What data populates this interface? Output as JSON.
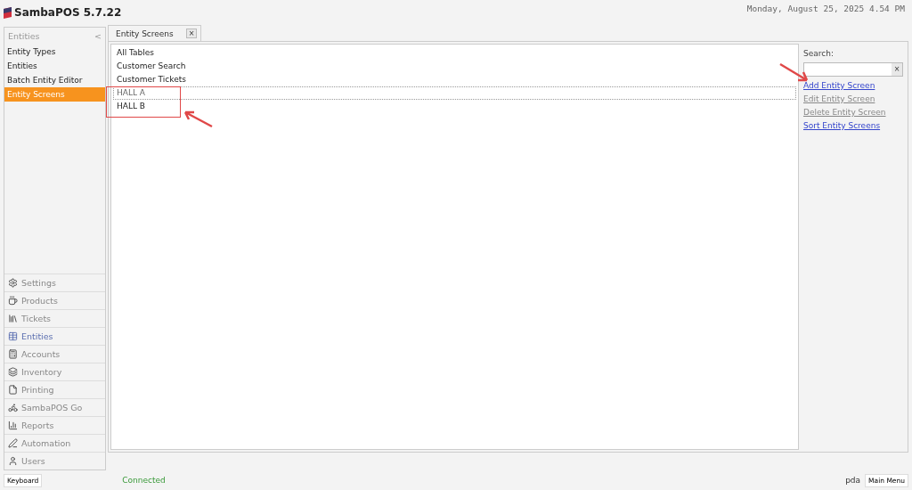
{
  "app": {
    "title": "SambaPOS 5.7.22",
    "datetime": "Monday, August 25, 2025 4.54 PM"
  },
  "section": {
    "title": "Entities",
    "collapse": "<",
    "items": [
      {
        "label": "Entity Types",
        "selected": false
      },
      {
        "label": "Entities",
        "selected": false
      },
      {
        "label": "Batch Entity Editor",
        "selected": false
      },
      {
        "label": "Entity Screens",
        "selected": true
      }
    ]
  },
  "nav": [
    {
      "label": "Settings",
      "kind": "settings",
      "selected": false
    },
    {
      "label": "Products",
      "kind": "products",
      "selected": false
    },
    {
      "label": "Tickets",
      "kind": "tickets",
      "selected": false
    },
    {
      "label": "Entities",
      "kind": "entities",
      "selected": true
    },
    {
      "label": "Accounts",
      "kind": "accounts",
      "selected": false
    },
    {
      "label": "Inventory",
      "kind": "inventory",
      "selected": false
    },
    {
      "label": "Printing",
      "kind": "printing",
      "selected": false
    },
    {
      "label": "SambaPOS Go",
      "kind": "go",
      "selected": false
    },
    {
      "label": "Reports",
      "kind": "reports",
      "selected": false
    },
    {
      "label": "Automation",
      "kind": "automation",
      "selected": false
    },
    {
      "label": "Users",
      "kind": "users",
      "selected": false
    }
  ],
  "tab": {
    "label": "Entity Screens",
    "close": "×"
  },
  "list": [
    {
      "label": "All Tables",
      "selected": false
    },
    {
      "label": "Customer Search",
      "selected": false
    },
    {
      "label": "Customer Tickets",
      "selected": false
    },
    {
      "label": "HALL A",
      "selected": true
    },
    {
      "label": "HALL B",
      "selected": false
    }
  ],
  "search": {
    "label": "Search:",
    "clear": "×"
  },
  "actions": [
    {
      "label": "Add Entity Screen",
      "disabled": false
    },
    {
      "label": "Edit Entity Screen",
      "disabled": true
    },
    {
      "label": "Delete Entity Screen",
      "disabled": true
    },
    {
      "label": "Sort Entity Screens",
      "disabled": false
    }
  ],
  "status_bar": {
    "keyboard": "Keyboard",
    "status": "Connected",
    "user": "pda",
    "main_menu": "Main Menu"
  }
}
